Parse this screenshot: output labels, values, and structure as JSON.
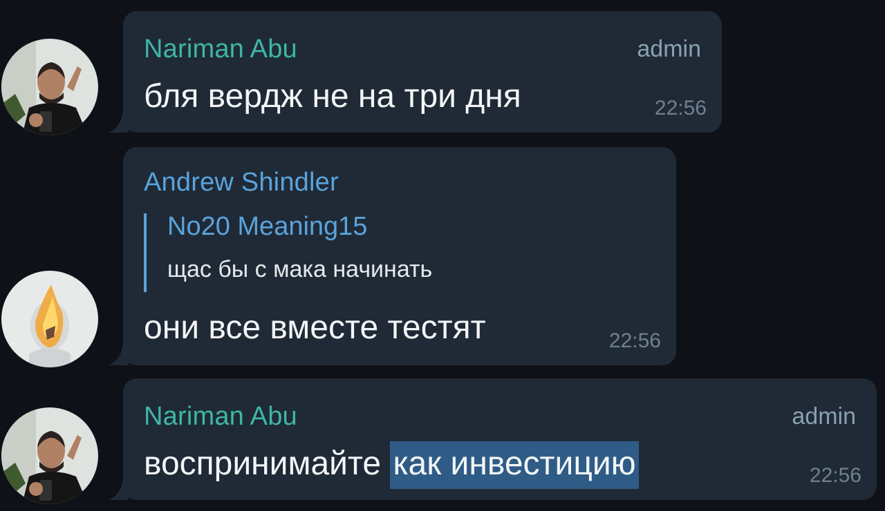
{
  "messages": [
    {
      "sender": "Nariman Abu",
      "role": "admin",
      "text": "бля вердж не на три дня",
      "time": "22:56",
      "avatar": "nariman-avatar"
    },
    {
      "sender": "Andrew Shindler",
      "reply": {
        "name": "No20 Meaning15",
        "text": "щас бы с мака начинать"
      },
      "text": "они все вместе тестят",
      "time": "22:56",
      "avatar": "andrew-avatar"
    },
    {
      "sender": "Nariman Abu",
      "role": "admin",
      "text_plain": "воспринимайте ",
      "text_selected": "как инвестицию",
      "time": "22:56",
      "avatar": "nariman-avatar"
    }
  ],
  "colors": {
    "background": "#0e1117",
    "bubble": "#1f2a36",
    "sender_teal": "#3fb6a4",
    "sender_blue": "#5ba3dc",
    "selection": "#2f5c86"
  }
}
